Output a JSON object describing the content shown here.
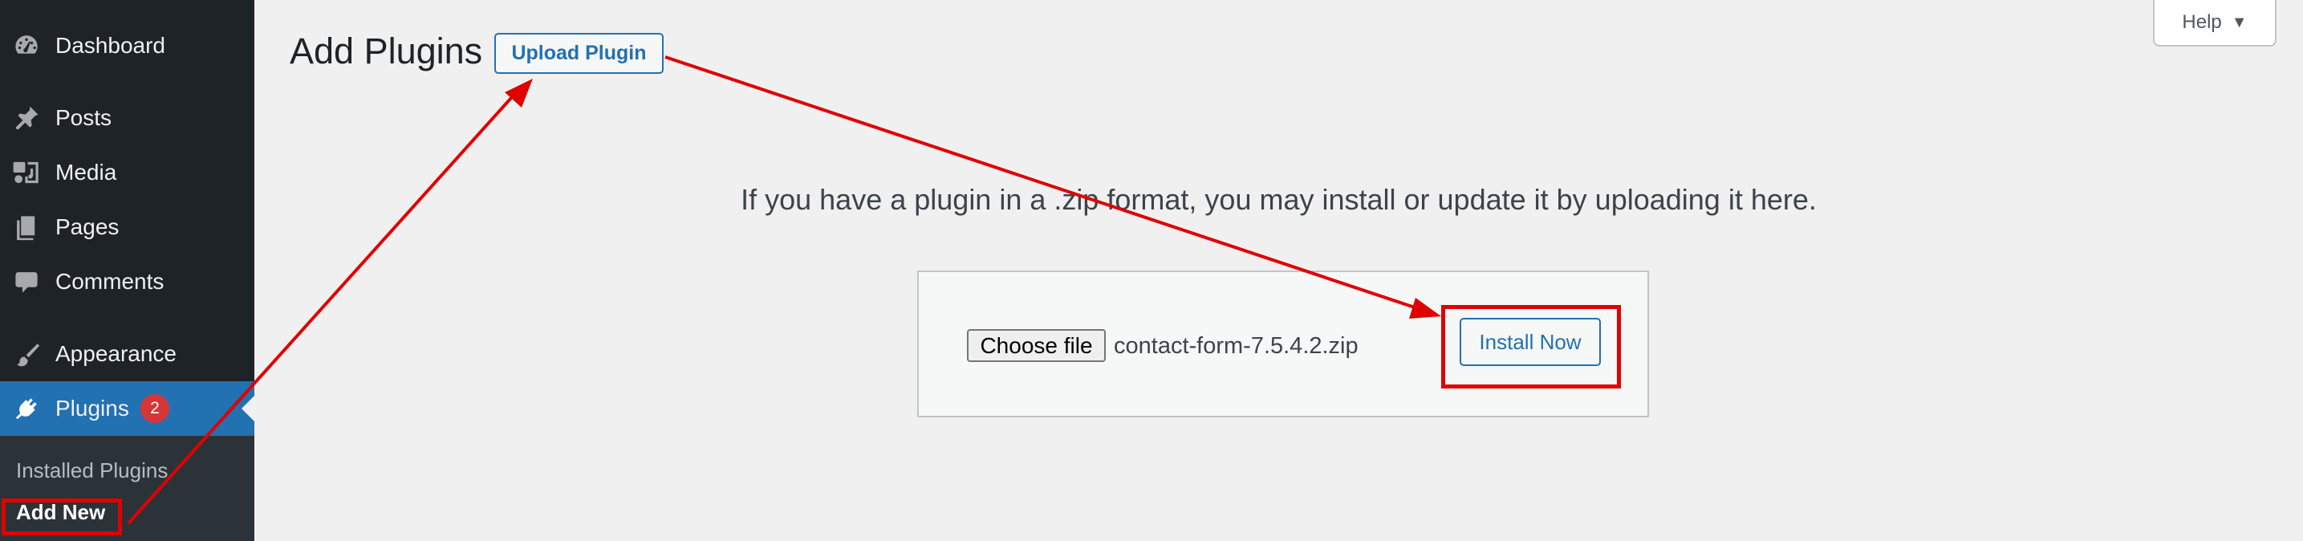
{
  "sidebar": {
    "items": [
      {
        "label": "Dashboard",
        "icon": "dashboard-icon"
      },
      {
        "label": "Posts",
        "icon": "pin-icon"
      },
      {
        "label": "Media",
        "icon": "media-icon"
      },
      {
        "label": "Pages",
        "icon": "pages-icon"
      },
      {
        "label": "Comments",
        "icon": "comment-icon"
      },
      {
        "label": "Appearance",
        "icon": "brush-icon"
      },
      {
        "label": "Plugins",
        "icon": "plugin-icon",
        "badge": "2",
        "active": true
      }
    ],
    "submenu": {
      "installed": "Installed Plugins",
      "add_new": "Add New"
    }
  },
  "header": {
    "title": "Add Plugins",
    "upload_button": "Upload Plugin",
    "help_button": "Help"
  },
  "upload": {
    "description": "If you have a plugin in a .zip format, you may install or update it by uploading it here.",
    "choose_file": "Choose file",
    "file_name": "contact-form-7.5.4.2.zip",
    "install_button": "Install Now"
  },
  "colors": {
    "sidebar_bg": "#1d2327",
    "active_bg": "#2271b1",
    "accent": "#2271b1",
    "annotation": "#e00000",
    "badge": "#d63638"
  }
}
